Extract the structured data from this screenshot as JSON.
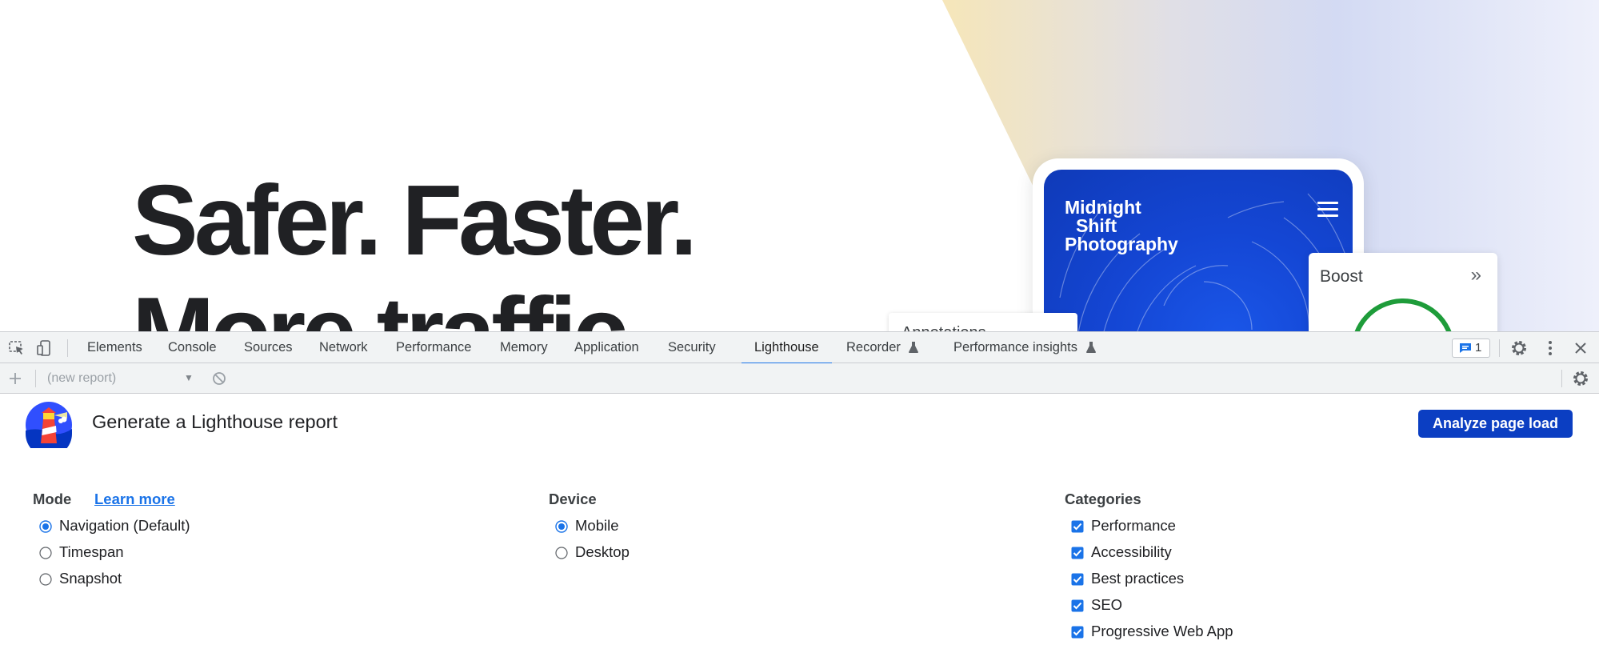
{
  "page": {
    "hero_line_1": "Safer. Faster.",
    "hero_line_2": "More traffic",
    "phone_title_1": "Midnight",
    "phone_title_2": "Shift",
    "phone_title_3": "Photography",
    "annotation_card_text": "Annotations",
    "boost_card_title": "Boost"
  },
  "devtools": {
    "tabs": [
      {
        "label": "Elements"
      },
      {
        "label": "Console"
      },
      {
        "label": "Sources"
      },
      {
        "label": "Network"
      },
      {
        "label": "Performance"
      },
      {
        "label": "Memory"
      },
      {
        "label": "Application"
      },
      {
        "label": "Security"
      },
      {
        "label": "Lighthouse"
      },
      {
        "label": "Recorder"
      },
      {
        "label": "Performance insights"
      }
    ],
    "active_tab": "Lighthouse",
    "issues_count": "1",
    "report_select_value": "(new report)"
  },
  "lighthouse": {
    "title": "Generate a Lighthouse report",
    "analyze_button": "Analyze page load",
    "mode": {
      "heading": "Mode",
      "learn_more": "Learn more",
      "options": [
        {
          "label": "Navigation (Default)",
          "checked": true
        },
        {
          "label": "Timespan",
          "checked": false
        },
        {
          "label": "Snapshot",
          "checked": false
        }
      ]
    },
    "device": {
      "heading": "Device",
      "options": [
        {
          "label": "Mobile",
          "checked": true
        },
        {
          "label": "Desktop",
          "checked": false
        }
      ]
    },
    "categories": {
      "heading": "Categories",
      "options": [
        {
          "label": "Performance",
          "checked": true
        },
        {
          "label": "Accessibility",
          "checked": true
        },
        {
          "label": "Best practices",
          "checked": true
        },
        {
          "label": "SEO",
          "checked": true
        },
        {
          "label": "Progressive Web App",
          "checked": true
        }
      ]
    }
  },
  "colors": {
    "accent": "#1a73e8",
    "button": "#0b3ec2",
    "toolbar_bg": "#f1f3f4"
  }
}
